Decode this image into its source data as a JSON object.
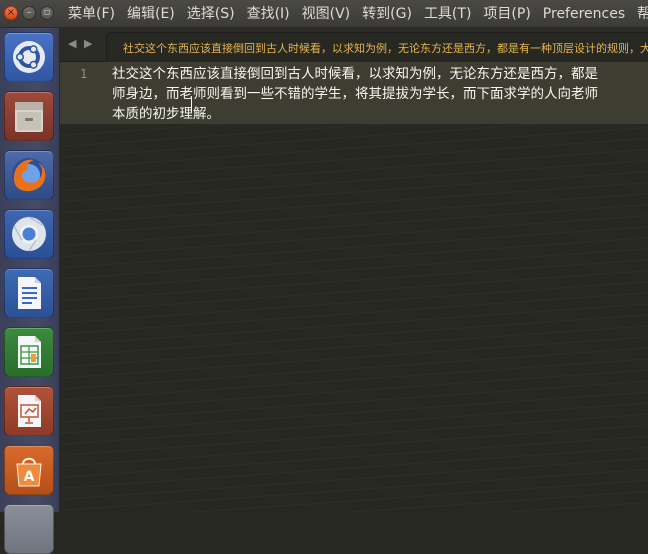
{
  "menubar": {
    "window_controls": [
      "close",
      "minimize",
      "maximize"
    ],
    "items": [
      "菜单(F)",
      "编辑(E)",
      "选择(S)",
      "查找(I)",
      "视图(V)",
      "转到(G)",
      "工具(T)",
      "项目(P)",
      "Preferences",
      "帮"
    ]
  },
  "launcher": {
    "items": [
      {
        "name": "ubuntu-dash-icon"
      },
      {
        "name": "files-icon"
      },
      {
        "name": "firefox-icon"
      },
      {
        "name": "chromium-icon"
      },
      {
        "name": "libreoffice-writer-icon"
      },
      {
        "name": "libreoffice-calc-icon"
      },
      {
        "name": "libreoffice-impress-icon"
      },
      {
        "name": "software-center-icon"
      }
    ]
  },
  "tabs": {
    "nav_prev": "◀",
    "nav_next": "▶",
    "active_title": "社交这个东西应该直接倒回到古人时候看，以求知为例，无论东方还是西方，都是有一种顶层设计的规则，大"
  },
  "editor": {
    "line_number": "1",
    "lines": [
      "社交这个东西应该直接倒回到古人时候看，以求知为例，无论东方还是西方，都是",
      "师身边，而老师则看到一些不错的学生，将其提拔为学长，而下面求学的人向老师",
      "本质的初步理解。"
    ]
  },
  "colors": {
    "editor_bg": "#272822",
    "current_line_bg": "#3e3d32",
    "tab_title": "#e6b450",
    "text": "#f8f8f2"
  }
}
